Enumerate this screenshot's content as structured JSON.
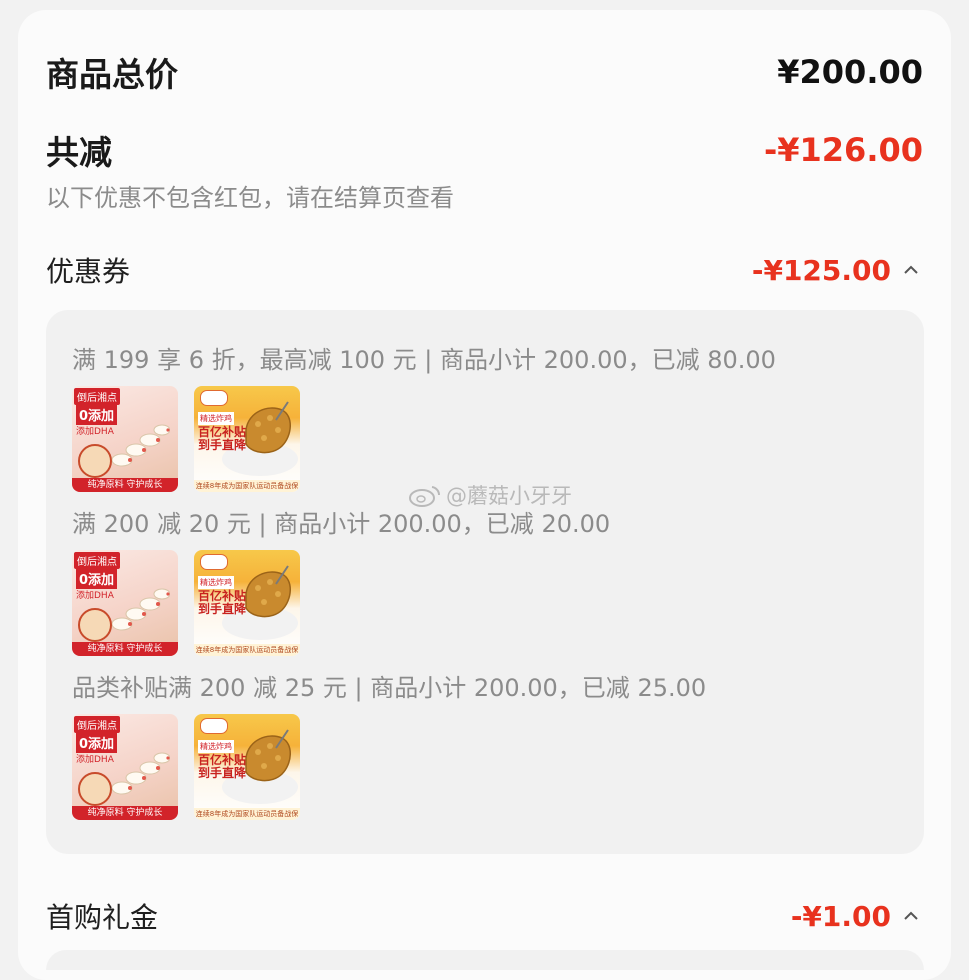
{
  "summary": {
    "total_label": "商品总价",
    "total_value": "¥200.00",
    "discount_label": "共减",
    "discount_value": "-¥126.00",
    "note": "以下优惠不包含红包，请在结算页查看"
  },
  "coupon_section": {
    "label": "优惠券",
    "value": "-¥125.00",
    "expand_icon": "chevron-up-icon",
    "rules": [
      {
        "text": "满 199 享 6 折，最高减 100 元 | 商品小计 200.00，已减 80.00"
      },
      {
        "text": "满 200 减 20 元 | 商品小计 200.00，已减 20.00"
      },
      {
        "text": "品类补贴满 200 减 25 元 | 商品小计 200.00，已减 25.00"
      }
    ],
    "thumb_a": {
      "brand": "倒后湘点",
      "add": "0添加",
      "dha": "添加DHA",
      "tagline": "纯净原料 守护成长"
    },
    "thumb_b": {
      "banner": "精选炸鸡",
      "headline1": "百亿补贴",
      "headline2": "到手直降",
      "band": "连续8年成为国家队运动员备战保障产品"
    }
  },
  "watermark": {
    "text": "@蘑菇小牙牙",
    "icon": "weibo-icon"
  },
  "first_purchase": {
    "label": "首购礼金",
    "value": "-¥1.00",
    "expand_icon": "chevron-up-icon"
  },
  "colors": {
    "accent_red": "#e8321e",
    "muted_text": "#8b8b8b"
  }
}
